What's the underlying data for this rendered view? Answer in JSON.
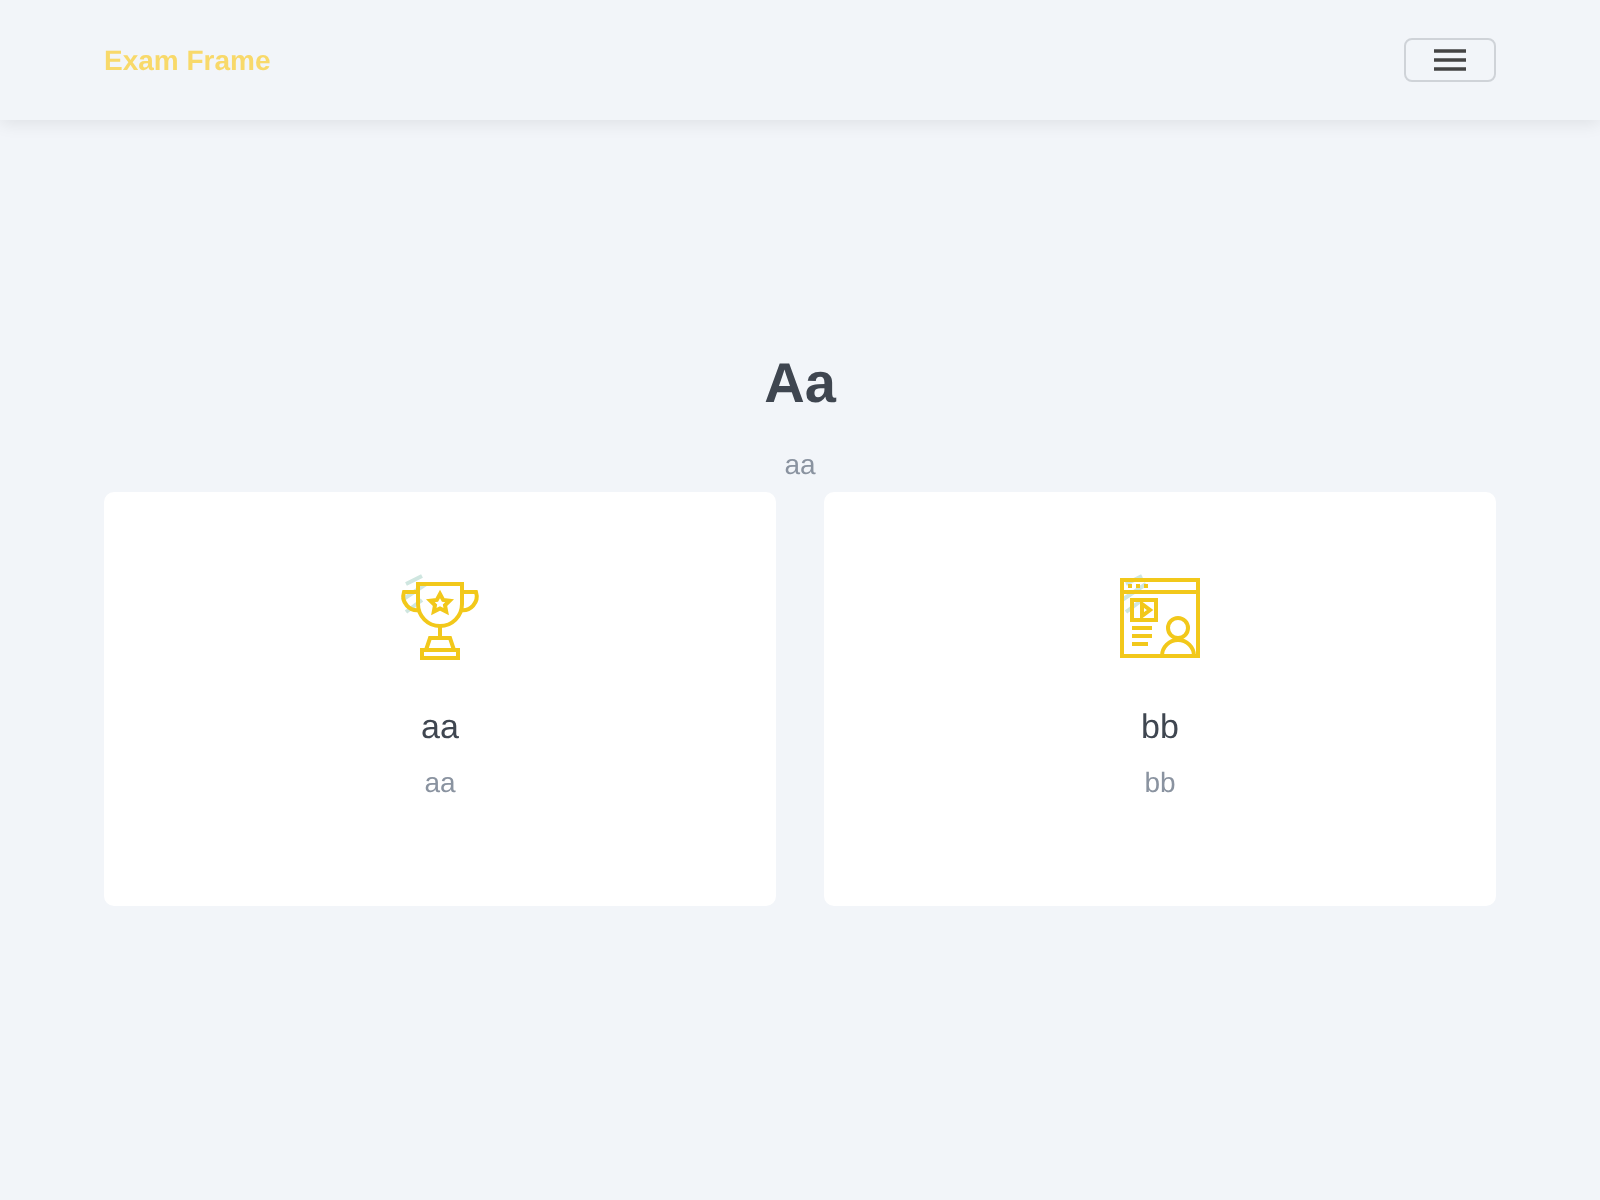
{
  "header": {
    "brand": "Exam Frame"
  },
  "hero": {
    "title": "Aa",
    "subtitle": "aa"
  },
  "cards": [
    {
      "kind": "trophy",
      "title": "aa",
      "subtitle": "aa"
    },
    {
      "kind": "video",
      "title": "bb",
      "subtitle": "bb"
    }
  ]
}
